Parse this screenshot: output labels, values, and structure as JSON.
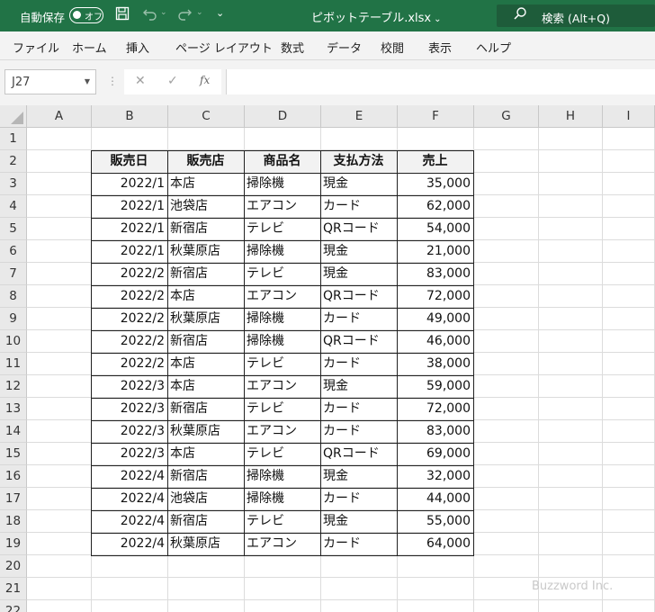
{
  "titlebar": {
    "autosave_label": "自動保存",
    "autosave_state": "オフ",
    "save_icon": "save-icon",
    "undo_icon": "undo-icon",
    "redo_icon": "redo-icon",
    "file_name": "ピボットテーブル.xlsx",
    "search_label": "検索 (Alt+Q)",
    "accent_color": "#217346"
  },
  "ribbon": {
    "tabs": [
      "ファイル",
      "ホーム",
      "挿入",
      "ページ レイアウト",
      "数式",
      "データ",
      "校閲",
      "表示",
      "ヘルプ"
    ]
  },
  "formula_bar": {
    "name_box": "J27",
    "cancel_glyph": "✕",
    "enter_glyph": "✓",
    "fx_glyph": "fx",
    "formula": ""
  },
  "sheet": {
    "columns": [
      "A",
      "B",
      "C",
      "D",
      "E",
      "F",
      "G",
      "H",
      "I"
    ],
    "rows": [
      "1",
      "2",
      "3",
      "4",
      "5",
      "6",
      "7",
      "8",
      "9",
      "10",
      "11",
      "12",
      "13",
      "14",
      "15",
      "16",
      "17",
      "18",
      "19",
      "20",
      "21",
      "22"
    ],
    "table": {
      "headers": [
        "販売日",
        "販売店",
        "商品名",
        "支払方法",
        "売上"
      ],
      "rows": [
        [
          "2022/1",
          "本店",
          "掃除機",
          "現金",
          "35,000"
        ],
        [
          "2022/1",
          "池袋店",
          "エアコン",
          "カード",
          "62,000"
        ],
        [
          "2022/1",
          "新宿店",
          "テレビ",
          "QRコード",
          "54,000"
        ],
        [
          "2022/1",
          "秋葉原店",
          "掃除機",
          "現金",
          "21,000"
        ],
        [
          "2022/2",
          "新宿店",
          "テレビ",
          "現金",
          "83,000"
        ],
        [
          "2022/2",
          "本店",
          "エアコン",
          "QRコード",
          "72,000"
        ],
        [
          "2022/2",
          "秋葉原店",
          "掃除機",
          "カード",
          "49,000"
        ],
        [
          "2022/2",
          "新宿店",
          "掃除機",
          "QRコード",
          "46,000"
        ],
        [
          "2022/2",
          "本店",
          "テレビ",
          "カード",
          "38,000"
        ],
        [
          "2022/3",
          "本店",
          "エアコン",
          "現金",
          "59,000"
        ],
        [
          "2022/3",
          "新宿店",
          "テレビ",
          "カード",
          "72,000"
        ],
        [
          "2022/3",
          "秋葉原店",
          "エアコン",
          "カード",
          "83,000"
        ],
        [
          "2022/3",
          "本店",
          "テレビ",
          "QRコード",
          "69,000"
        ],
        [
          "2022/4",
          "新宿店",
          "掃除機",
          "現金",
          "32,000"
        ],
        [
          "2022/4",
          "池袋店",
          "掃除機",
          "カード",
          "44,000"
        ],
        [
          "2022/4",
          "新宿店",
          "テレビ",
          "現金",
          "55,000"
        ],
        [
          "2022/4",
          "秋葉原店",
          "エアコン",
          "カード",
          "64,000"
        ]
      ]
    }
  },
  "watermark": "Buzzword Inc."
}
